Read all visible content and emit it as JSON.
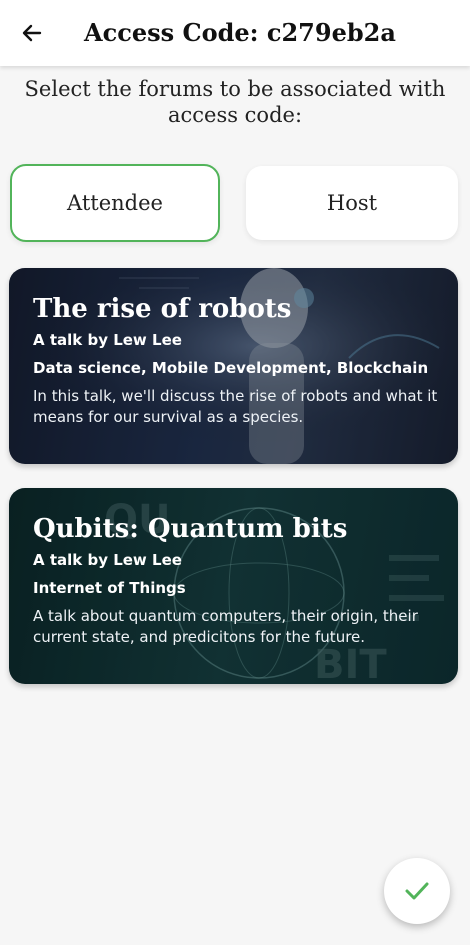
{
  "header": {
    "title": "Access Code: c279eb2a",
    "back_icon": "arrow-left-icon"
  },
  "prompt": "Select the forums to be associated with access code:",
  "roles": [
    {
      "label": "Attendee",
      "selected": true
    },
    {
      "label": "Host",
      "selected": false
    }
  ],
  "accent_color": "#52b45a",
  "talks": [
    {
      "title": "The rise of robots",
      "speaker": "A talk by Lew Lee",
      "tags": "Data science, Mobile Development, Blockchain",
      "description": "In this talk, we'll discuss the rise of robots and what it means for our survival as a species."
    },
    {
      "title": "Qubits: Quantum bits",
      "speaker": "A talk by Lew Lee",
      "tags": "Internet of Things",
      "description": "A talk about quantum computers, their origin, their current state, and predicitons for the future."
    }
  ],
  "fab": {
    "icon": "check-icon"
  }
}
